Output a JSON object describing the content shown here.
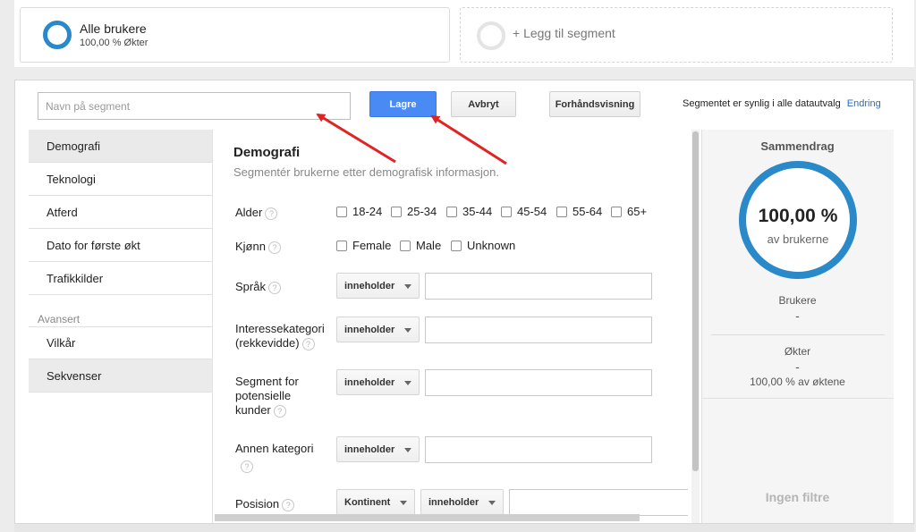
{
  "segments": {
    "active": {
      "title": "Alle brukere",
      "subtitle": "100,00 % Økter"
    },
    "add_label": "+ Legg til segment"
  },
  "toolbar": {
    "name_placeholder": "Navn på segment",
    "save_label": "Lagre",
    "cancel_label": "Avbryt",
    "preview_label": "Forhåndsvisning",
    "visibility_text": "Segmentet er synlig i alle datautvalg",
    "change_link": "Endring"
  },
  "nav": {
    "items": [
      "Demografi",
      "Teknologi",
      "Atferd",
      "Dato for første økt",
      "Trafikkilder"
    ],
    "group_label": "Avansert",
    "advanced_items": [
      "Vilkår",
      "Sekvenser"
    ]
  },
  "section": {
    "title": "Demografi",
    "subtitle": "Segmentér brukerne etter demografisk informasjon."
  },
  "fields": {
    "age_label": "Alder",
    "age_options": [
      "18-24",
      "25-34",
      "35-44",
      "45-54",
      "55-64",
      "65+"
    ],
    "gender_label": "Kjønn",
    "gender_options": [
      "Female",
      "Male",
      "Unknown"
    ],
    "language_label": "Språk",
    "interest_label_1": "Interessekategori",
    "interest_label_2": "(rekkevidde)",
    "potential_label_1": "Segment for",
    "potential_label_2": "potensielle",
    "potential_label_3": "kunder",
    "other_label": "Annen kategori",
    "position_label": "Posision",
    "operator": "inneholder",
    "continent": "Kontinent",
    "help_glyph": "?"
  },
  "summary": {
    "title": "Sammendrag",
    "percent": "100,00 %",
    "percent_sub": "av brukerne",
    "users_label": "Brukere",
    "users_value": "-",
    "sessions_label": "Økter",
    "sessions_value": "-",
    "sessions_pct": "100,00 % av øktene",
    "no_filters": "Ingen filtre"
  },
  "colors": {
    "accent": "#2a89c9",
    "save": "#4a8af4",
    "arrow": "#e02424"
  }
}
